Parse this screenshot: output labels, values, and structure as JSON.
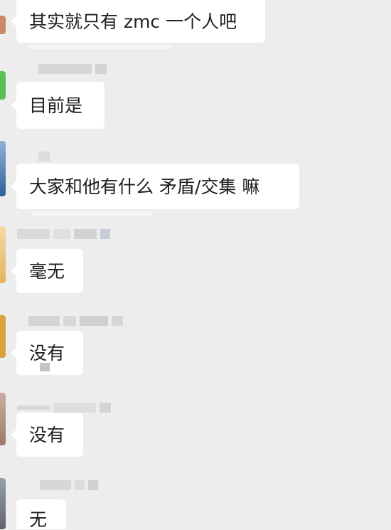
{
  "chat": {
    "messages": [
      {
        "text": "其实就只有 zmc 一个人吧",
        "avatar_color": "#c98a6a"
      },
      {
        "text": "目前是",
        "avatar_color": "#5cbf55"
      },
      {
        "text": "大家和他有什么 矛盾/交集 嘛",
        "avatar_color": "#3a6ea8"
      },
      {
        "text": "毫无",
        "avatar_color": "#e8c070"
      },
      {
        "text": "没有",
        "avatar_color": "#d9a23a"
      },
      {
        "text": "没有",
        "avatar_color": "#b08878"
      },
      {
        "text": "无",
        "avatar_color": "#7a7f86"
      }
    ]
  }
}
